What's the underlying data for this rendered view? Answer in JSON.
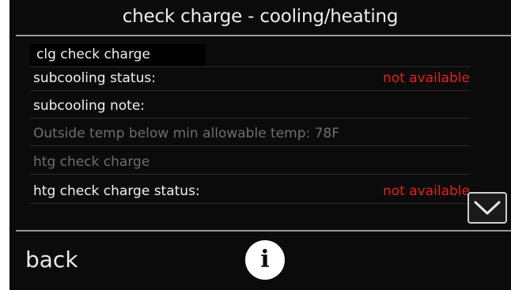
{
  "header": {
    "title": "check charge - cooling/heating"
  },
  "rows": [
    {
      "label": "clg check charge",
      "value": ""
    },
    {
      "label": "subcooling status:",
      "value": "not available"
    },
    {
      "label": "subcooling note:",
      "value": ""
    },
    {
      "label": "Outside temp below min allowable temp: 78F",
      "value": ""
    },
    {
      "label": "htg check charge",
      "value": ""
    },
    {
      "label": "htg check charge status:",
      "value": "not available"
    }
  ],
  "footer": {
    "back_label": "back",
    "info_icon": "info-icon",
    "scroll_icon": "chevron-down-icon"
  },
  "colors": {
    "background": "#0b0b0b",
    "text": "#f0f0f0",
    "dim_text": "#6e6e6e",
    "status_red": "#e22020"
  }
}
